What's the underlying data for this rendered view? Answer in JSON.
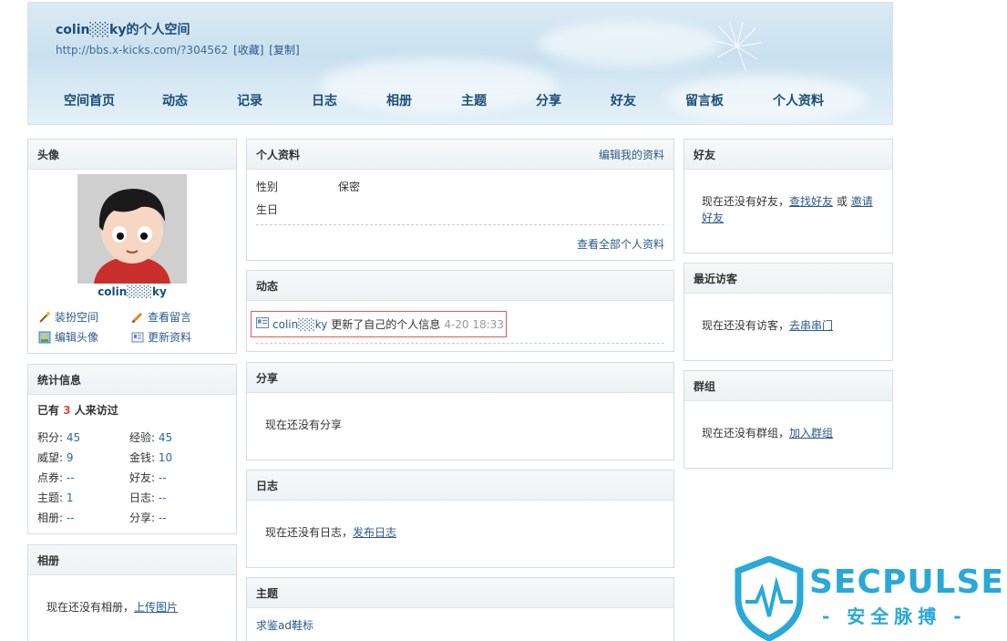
{
  "header": {
    "title": "colin░░ky的个人空间",
    "url": "http://bbs.x-kicks.com/?304562",
    "favorite": "[收藏]",
    "copy": "[复制]",
    "nav": [
      "空间首页",
      "动态",
      "记录",
      "日志",
      "相册",
      "主题",
      "分享",
      "好友",
      "留言板",
      "个人资料"
    ]
  },
  "avatar_box": {
    "title": "头像",
    "username": "colin░░░ky",
    "actions": [
      {
        "label": "装扮空间",
        "icon": "wand-icon"
      },
      {
        "label": "查看留言",
        "icon": "pencil-icon"
      },
      {
        "label": "编辑头像",
        "icon": "image-icon"
      },
      {
        "label": "更新资料",
        "icon": "card-icon"
      }
    ]
  },
  "stats_box": {
    "title": "统计信息",
    "visitors_prefix": "已有",
    "visitors_count": "3",
    "visitors_suffix": "人来访过",
    "items": [
      {
        "label": "积分:",
        "value": "45"
      },
      {
        "label": "经验:",
        "value": "45"
      },
      {
        "label": "威望:",
        "value": "9"
      },
      {
        "label": "金钱:",
        "value": "10"
      },
      {
        "label": "点券:",
        "value": "--"
      },
      {
        "label": "好友:",
        "value": "--"
      },
      {
        "label": "主题:",
        "value": "1"
      },
      {
        "label": "日志:",
        "value": "--"
      },
      {
        "label": "相册:",
        "value": "--"
      },
      {
        "label": "分享:",
        "value": "--"
      }
    ]
  },
  "album_box": {
    "title": "相册",
    "empty": "现在还没有相册，",
    "link": "上传图片"
  },
  "profile_box": {
    "title": "个人资料",
    "edit": "编辑我的资料",
    "gender_label": "性别",
    "gender_value": "保密",
    "birthday_label": "生日",
    "view_all": "查看全部个人资料"
  },
  "feed_box": {
    "title": "动态",
    "user": "colin░░ky",
    "text": "更新了自己的个人信息",
    "time": "4-20 18:33"
  },
  "share_box": {
    "title": "分享",
    "empty": "现在还没有分享"
  },
  "blog_box": {
    "title": "日志",
    "empty": "现在还没有日志，",
    "link": "发布日志"
  },
  "topic_box": {
    "title": "主题",
    "item": "求鉴ad鞋标"
  },
  "friends_box": {
    "title": "好友",
    "empty": "现在还没有好友，",
    "link1": "查找好友",
    "or": "或",
    "link2": "邀请好友"
  },
  "visitors_box": {
    "title": "最近访客",
    "empty": "现在还没有访客，",
    "link": "去串串门"
  },
  "groups_box": {
    "title": "群组",
    "empty": "现在还没有群组，",
    "link": "加入群组"
  },
  "watermark": {
    "brand": "SECPULSE",
    "sub": "- 安全脉搏 -"
  },
  "colors": {
    "accent": "#1b4d78",
    "link": "#2b5a8a",
    "highlight": "#e25858",
    "count": "#e04a3a"
  }
}
